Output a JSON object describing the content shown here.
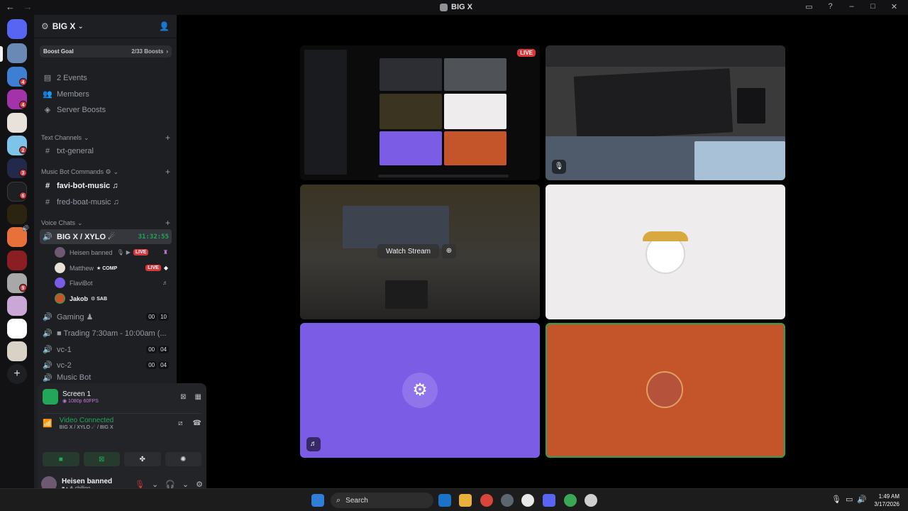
{
  "window": {
    "title": "BIG X",
    "back": "←",
    "forward": "→"
  },
  "server": {
    "name": "BIG X"
  },
  "boost": {
    "label": "Boost Goal",
    "count": "2/33 Boosts"
  },
  "nav_items": [
    {
      "label": "2 Events"
    },
    {
      "label": "Members"
    },
    {
      "label": "Server Boosts"
    }
  ],
  "categories": {
    "text": "Text Channels",
    "music": "Music Bot Commands ⚙",
    "voice": "Voice Chats"
  },
  "channels": {
    "txt_general": "txt-general",
    "favi": "favi-bot-music ♫",
    "fred": "fred-boat-music ♫",
    "bigx": "BIG X / XYLO ☄",
    "bigx_timer": "31:32:55",
    "gaming": "Gaming ♟",
    "gaming_a": "00",
    "gaming_b": "10",
    "trading": "■ Trading 7:30am - 10:00am (...",
    "vc1": "vc-1",
    "vc1_a": "00",
    "vc1_b": "04",
    "vc2": "vc-2",
    "vc2_a": "00",
    "vc2_b": "04",
    "musicbot": "Music Bot"
  },
  "voice_users": [
    {
      "name": "Heisen banned",
      "live": "LIVE"
    },
    {
      "name": "Matthew",
      "tag": "★ COMP",
      "live": "LIVE"
    },
    {
      "name": "FlaviBot"
    },
    {
      "name": "Jakob",
      "tag": "⚙ SAB"
    }
  ],
  "panel": {
    "screen_title": "Screen 1",
    "screen_sub": "◉ 1080p 60FPS",
    "vc_title": "Video Connected",
    "vc_sub": "BIG X / XYLO ☄ / BIG X",
    "user_name": "Heisen banned",
    "user_status": "■ • ⚘ chilling"
  },
  "stream": {
    "live": "LIVE",
    "watch": "Watch Stream"
  },
  "taskbar": {
    "search": "Search",
    "time": "1:49 AM",
    "date": "3/17/2026"
  },
  "colors": {
    "accent_green": "#23a55a",
    "live_red": "#da373c",
    "bot_purple": "#7b5ce4",
    "orange": "#c4542a"
  }
}
